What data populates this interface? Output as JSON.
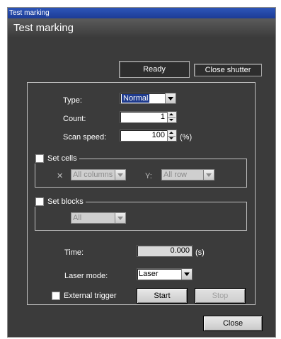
{
  "window": {
    "titlebar_text": "Test marking",
    "header_text": "Test marking"
  },
  "top_buttons": {
    "ready": "Ready",
    "close_shutter": "Close shutter"
  },
  "form": {
    "type": {
      "label": "Type:",
      "value": "Normal"
    },
    "count": {
      "label": "Count:",
      "value": "1"
    },
    "scan_speed": {
      "label": "Scan speed:",
      "value": "100",
      "unit": "(%)"
    }
  },
  "set_cells": {
    "checkbox_label": "Set cells",
    "x_label": "X:",
    "x_value": "All columns",
    "y_label": "Y:",
    "y_value": "All row"
  },
  "set_blocks": {
    "checkbox_label": "Set blocks",
    "value": "All"
  },
  "time": {
    "label": "Time:",
    "value": "0.000",
    "unit": "(s)"
  },
  "laser_mode": {
    "label": "Laser mode:",
    "value": "Laser"
  },
  "external_trigger": {
    "label": "External trigger"
  },
  "actions": {
    "start": "Start",
    "stop": "Stop",
    "close": "Close"
  },
  "icons": {
    "x_icon": "x-axis-icon",
    "y_icon": "y-axis-icon"
  }
}
